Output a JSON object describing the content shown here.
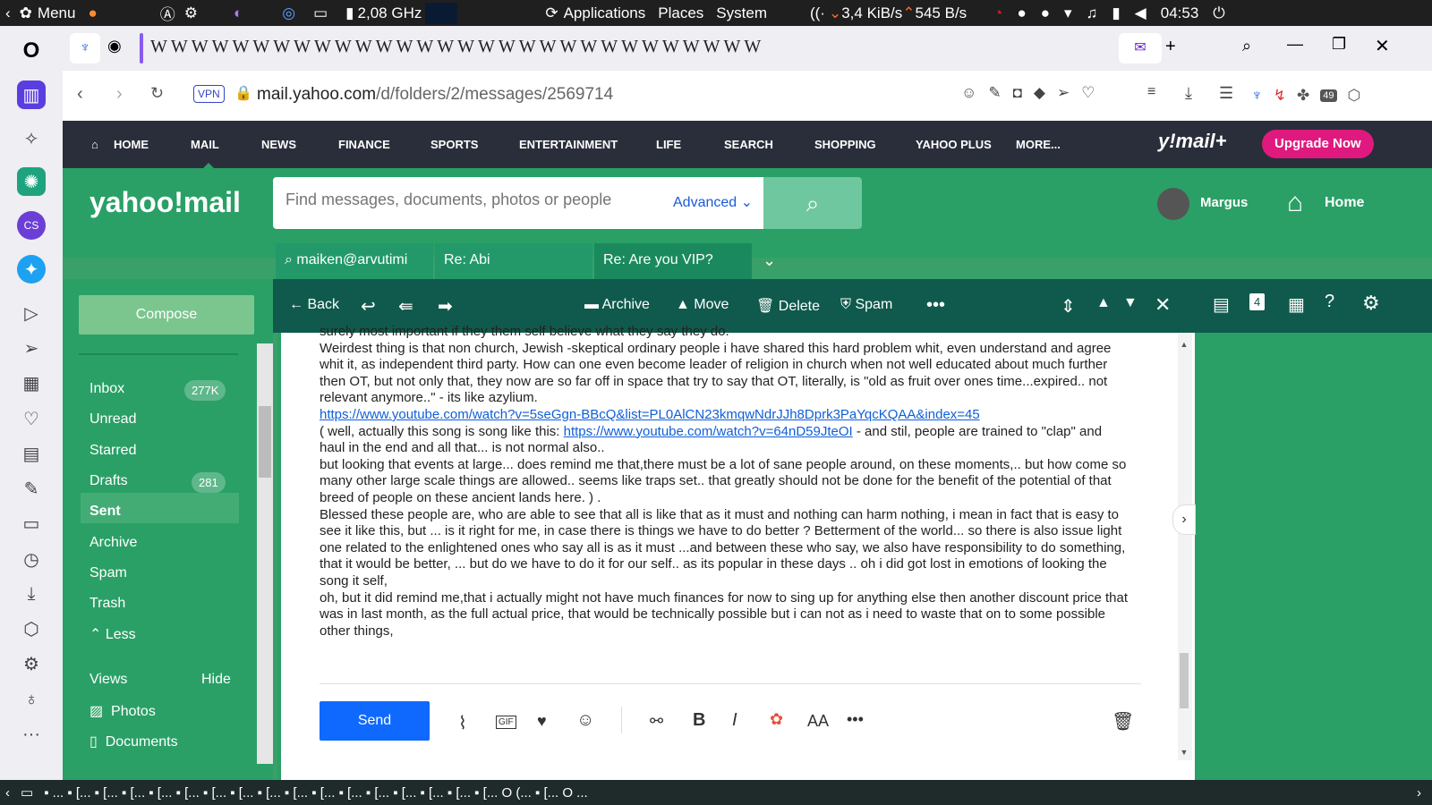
{
  "system_bar": {
    "menu": "Menu",
    "cpu": "2,08 GHz",
    "apps": "Applications",
    "places": "Places",
    "system": "System",
    "net_down": "3,4 KiB/s",
    "net_up": "545 B/s",
    "time": "04:53"
  },
  "browser": {
    "url_domain": "mail.yahoo.com",
    "url_path": "/d/folders/2/messages/2569714",
    "vpn": "VPN",
    "ext_badge": "49"
  },
  "yahoo_nav": {
    "home": "HOME",
    "mail": "MAIL",
    "news": "NEWS",
    "finance": "FINANCE",
    "sports": "SPORTS",
    "entertainment": "ENTERTAINMENT",
    "life": "LIFE",
    "search": "SEARCH",
    "shopping": "SHOPPING",
    "yahoo_plus": "YAHOO PLUS",
    "more": "MORE...",
    "brand": "y!mail+",
    "upgrade": "Upgrade Now"
  },
  "header": {
    "logo": "yahoo!mail",
    "search_placeholder": "Find messages, documents, photos or people",
    "advanced": "Advanced",
    "user": "Margus",
    "home": "Home"
  },
  "tabs": [
    "maiken@arvutimi",
    "Re: Abi",
    "Re: Are you VIP?"
  ],
  "sidebar": {
    "compose": "Compose",
    "folders": [
      {
        "label": "Inbox",
        "count": "277K"
      },
      {
        "label": "Unread"
      },
      {
        "label": "Starred"
      },
      {
        "label": "Drafts",
        "count": "281"
      },
      {
        "label": "Sent"
      },
      {
        "label": "Archive"
      },
      {
        "label": "Spam"
      },
      {
        "label": "Trash"
      }
    ],
    "less": "Less",
    "views": "Views",
    "hide": "Hide",
    "photos": "Photos",
    "documents": "Documents"
  },
  "toolbar": {
    "back": "Back",
    "archive": "Archive",
    "move": "Move",
    "delete": "Delete",
    "spam": "Spam",
    "calendar_badge": "4"
  },
  "message": {
    "line0": "surely most important if they them self believe what they say they do.",
    "p1": "Weirdest thing is that non church, Jewish -skeptical ordinary people i have shared this hard problem whit, even understand and agree whit it, as independent third party. How can one even become leader of religion in church when not well educated about much further then OT, but not only that, they now are so far off in space that try to say that OT, literally, is \"old as fruit over ones time...expired.. not relevant anymore..\"  - its like azylium.",
    "link1": "https://www.youtube.com/watch?v=5seGgn-BBcQ&list=PL0AlCN23kmqwNdrJJh8Dprk3PaYqcKQAA&index=45",
    "p2a": "( well, actually this song is song like this: ",
    "link2": "https://www.youtube.com/watch?v=64nD59JteOI",
    "p2b": " - and stil, people are trained to \"clap\" and haul in the end and all that... is not normal also..",
    "p3": "but looking that events at large...  does remind me that,there must be a lot of sane people around, on these moments,.. but how come so many other large scale things are allowed.. seems like traps set.. that greatly should not be done for the benefit of the potential of that breed of people on these ancient lands here. ) .",
    "p4": "Blessed these people are, who are able to see that all is like that as it must and nothing can harm nothing, i mean in fact that is easy to see it like this, but ... is it right for me, in case there is things we have to do better ? Betterment of the world...  so there is also issue light one related to the enlightened ones who say all is as it must ...and between these who say, we also have responsibility to do something, that it would be better, ... but do we have to do it for our self.. as its popular in these days .. oh i did got lost in emotions of looking the song it self,",
    "p5": "oh, but it did remind me,that i actually might not have much finances for now to sing up for anything else then another discount price that was in last month, as the full actual price, that would be technically possible but i can not as i need to waste that on to some possible other things,"
  },
  "composer": {
    "send": "Send"
  },
  "colors": {
    "green": "#2aa066",
    "dark_green": "#0f5a4c",
    "send_blue": "#0f69ff",
    "upgrade_pink": "#e0197f"
  }
}
